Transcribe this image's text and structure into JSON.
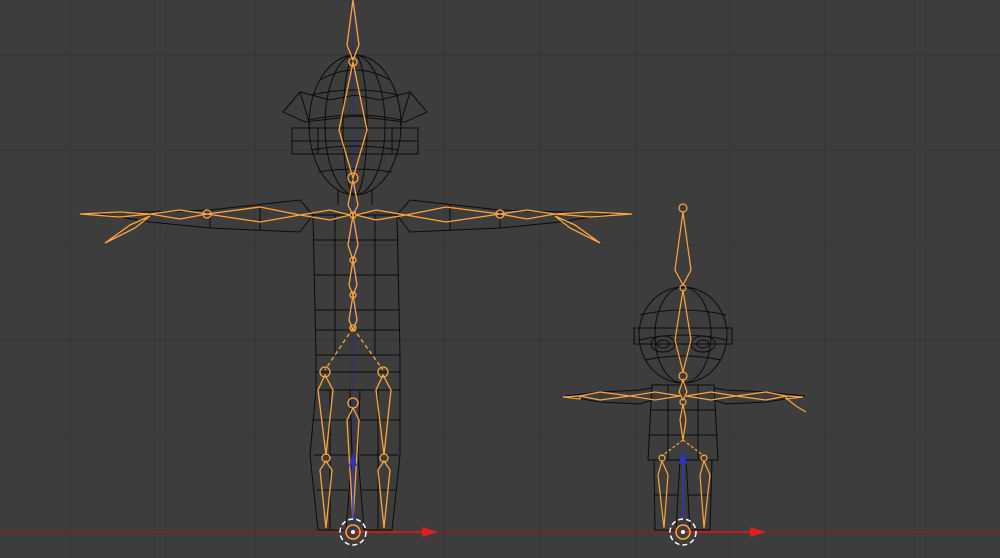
{
  "viewport": {
    "background": "#3d3d3d",
    "grid_color": "#353535",
    "grid_visible": true
  },
  "colors": {
    "armature": "#ffa53a",
    "armature_dark": "#d98a22",
    "mesh_wire": "#0b0b0b",
    "x_axis": "#c61b1b",
    "z_axis": "#2e33c8",
    "cursor_ring": "#ffffff",
    "cursor_accent": "#d42020"
  },
  "objects": [
    {
      "name": "large-character",
      "kind": "rigged-mesh"
    },
    {
      "name": "small-character",
      "kind": "rigged-mesh"
    }
  ]
}
